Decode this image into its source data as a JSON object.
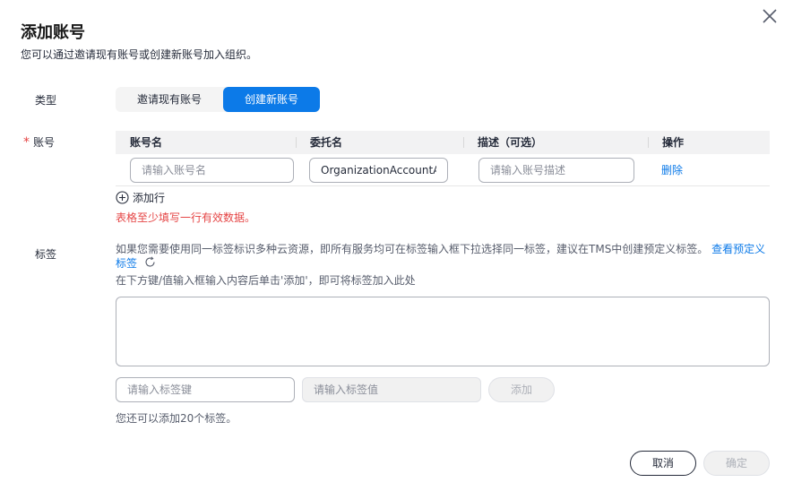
{
  "dialog": {
    "title": "添加账号",
    "subtitle": "您可以通过邀请现有账号或创建新账号加入组织。"
  },
  "type_field": {
    "label": "类型",
    "options": [
      "邀请现有账号",
      "创建新账号"
    ],
    "selected": "创建新账号"
  },
  "account_field": {
    "label": "账号",
    "required": true,
    "columns": [
      "账号名",
      "委托名",
      "描述（可选）",
      "操作"
    ],
    "rows": [
      {
        "name_placeholder": "请输入账号名",
        "name_value": "",
        "agency_value": "OrganizationAccountAccessAgency",
        "desc_placeholder": "请输入账号描述",
        "action": "删除"
      }
    ],
    "add_row_label": "添加行",
    "error": "表格至少填写一行有效数据。"
  },
  "tag_field": {
    "label": "标签",
    "hint": "如果您需要使用同一标签标识多种云资源，即所有服务均可在标签输入框下拉选择同一标签，建议在TMS中创建预定义标签。",
    "hint_link": "查看预定义标签",
    "hint2": "在下方键/值输入框输入内容后单击'添加'，即可将标签加入此处",
    "key_placeholder": "请输入标签键",
    "value_placeholder": "请输入标签值",
    "add_label": "添加",
    "remaining": "您还可以添加20个标签。"
  },
  "footer": {
    "cancel_label": "取消",
    "confirm_label": "确定"
  },
  "colors": {
    "primary": "#0c7ae8",
    "error": "#e54545",
    "text": "#252b3a"
  },
  "icons": [
    "close-icon",
    "add-circle-icon",
    "refresh-icon"
  ]
}
